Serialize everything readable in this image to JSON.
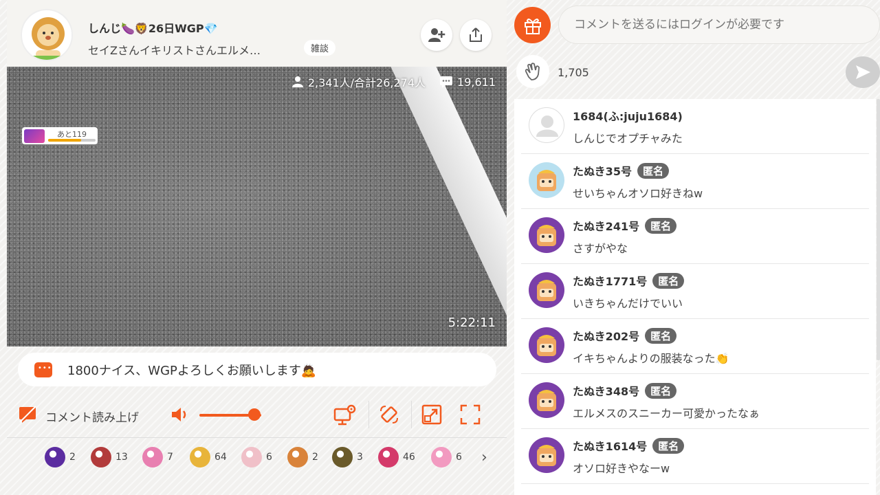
{
  "header": {
    "streamer_name": "しんじ🍆🦁26日WGP💎",
    "stream_title": "セイZさんイキリストさんエルメ…",
    "category": "雑談",
    "follow_icon": "add-user-icon",
    "share_icon": "share-icon"
  },
  "video": {
    "viewers": "2,341人/合計26,274人",
    "comment_count": "19,611",
    "gift_goal_label": "あと119",
    "gift_goal_progress": 0.7,
    "elapsed": "5:22:11"
  },
  "telop": {
    "text": "1800ナイス、WGPよろしくお願いします🙇"
  },
  "controls": {
    "tts_label": "コメント読み上げ",
    "volume_level": 0.85
  },
  "gifts": [
    {
      "icon": "purple-badge-gift-icon",
      "count": "2",
      "color": "#5b2ca0"
    },
    {
      "icon": "panda-gift-icon",
      "count": "13",
      "color": "#b23b3b"
    },
    {
      "icon": "cake-gift-icon",
      "count": "7",
      "color": "#e87fb0"
    },
    {
      "icon": "horn-gift-icon",
      "count": "64",
      "color": "#e8b43a"
    },
    {
      "icon": "mouse-gift-icon",
      "count": "6",
      "color": "#f0c0c8"
    },
    {
      "icon": "character-gift-icon",
      "count": "2",
      "color": "#d9833a"
    },
    {
      "icon": "popper-gift-icon",
      "count": "3",
      "color": "#6a5a2a"
    },
    {
      "icon": "hearts-gift-icon",
      "count": "46",
      "color": "#d43a6a"
    },
    {
      "icon": "present-gift-icon",
      "count": "6",
      "color": "#f29ac0"
    }
  ],
  "chat": {
    "input_placeholder": "コメントを送るにはログインが必要です",
    "clap_count": "1,705",
    "anon_label": "匿名",
    "comments": [
      {
        "name": "1684(ふ:juju1684)",
        "text": "しんじでオプチャみた",
        "anon": false
      },
      {
        "name": "たぬき35号",
        "text": "せいちゃんオソロ好きねw",
        "anon": true
      },
      {
        "name": "たぬき241号",
        "text": "さすがやな",
        "anon": true
      },
      {
        "name": "たぬき1771号",
        "text": "いきちゃんだけでいい",
        "anon": true
      },
      {
        "name": "たぬき202号",
        "text": "イキちゃんよりの服装なった👏",
        "anon": true
      },
      {
        "name": "たぬき348号",
        "text": "エルメスのスニーカー可愛かったなぁ",
        "anon": true
      },
      {
        "name": "たぬき1614号",
        "text": "オソロ好きやなーw",
        "anon": true
      }
    ]
  },
  "colors": {
    "accent": "#f25a1e",
    "anon_badge": "#666666"
  }
}
